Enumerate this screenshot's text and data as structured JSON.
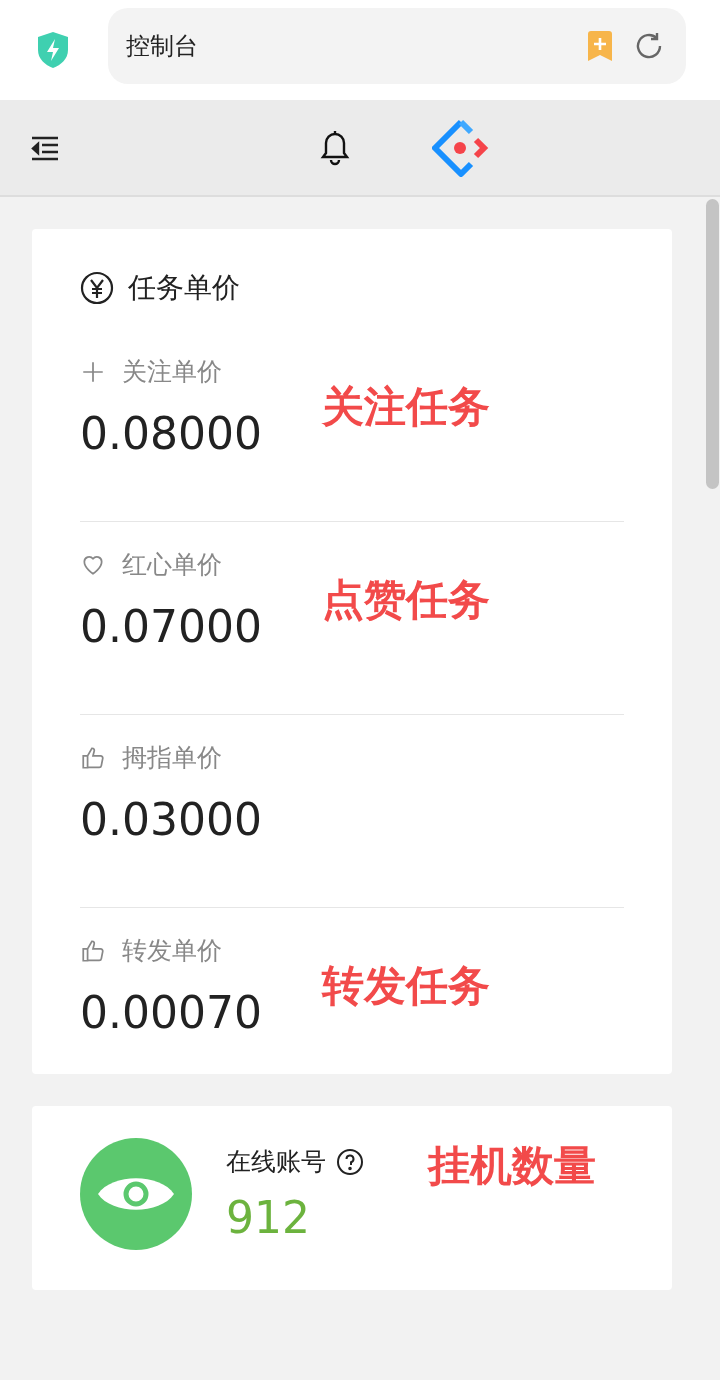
{
  "browser": {
    "address": "控制台"
  },
  "price_card": {
    "title": "任务单价",
    "items": [
      {
        "kind": "plus",
        "label": "关注单价",
        "value": "0.08000",
        "annotation": "关注任务"
      },
      {
        "kind": "heart",
        "label": "红心单价",
        "value": "0.07000",
        "annotation": "点赞任务"
      },
      {
        "kind": "thumb",
        "label": "拇指单价",
        "value": "0.03000"
      },
      {
        "kind": "thumb",
        "label": "转发单价",
        "value": "0.00070",
        "annotation": "转发任务"
      }
    ]
  },
  "online_card": {
    "label": "在线账号",
    "value": "912",
    "annotation": "挂机数量"
  }
}
